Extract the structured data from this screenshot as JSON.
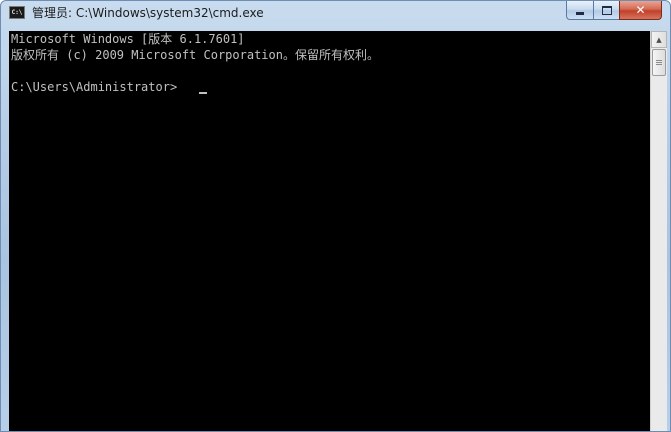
{
  "window": {
    "title": "管理员: C:\\Windows\\system32\\cmd.exe",
    "icon": "cmd-console-icon",
    "icon_text": "C:\\"
  },
  "caption_buttons": {
    "minimize": "minimize-icon",
    "maximize": "maximize-icon",
    "close": "close-icon",
    "close_glyph": "✕"
  },
  "console": {
    "lines": [
      "Microsoft Windows [版本 6.1.7601]",
      "版权所有 (c) 2009 Microsoft Corporation。保留所有权利。",
      "C:\\Users\\Administrator>"
    ],
    "text_color": "#c0c0c0",
    "background_color": "#000000"
  },
  "scrollbar": {
    "up_arrow": "▲"
  }
}
